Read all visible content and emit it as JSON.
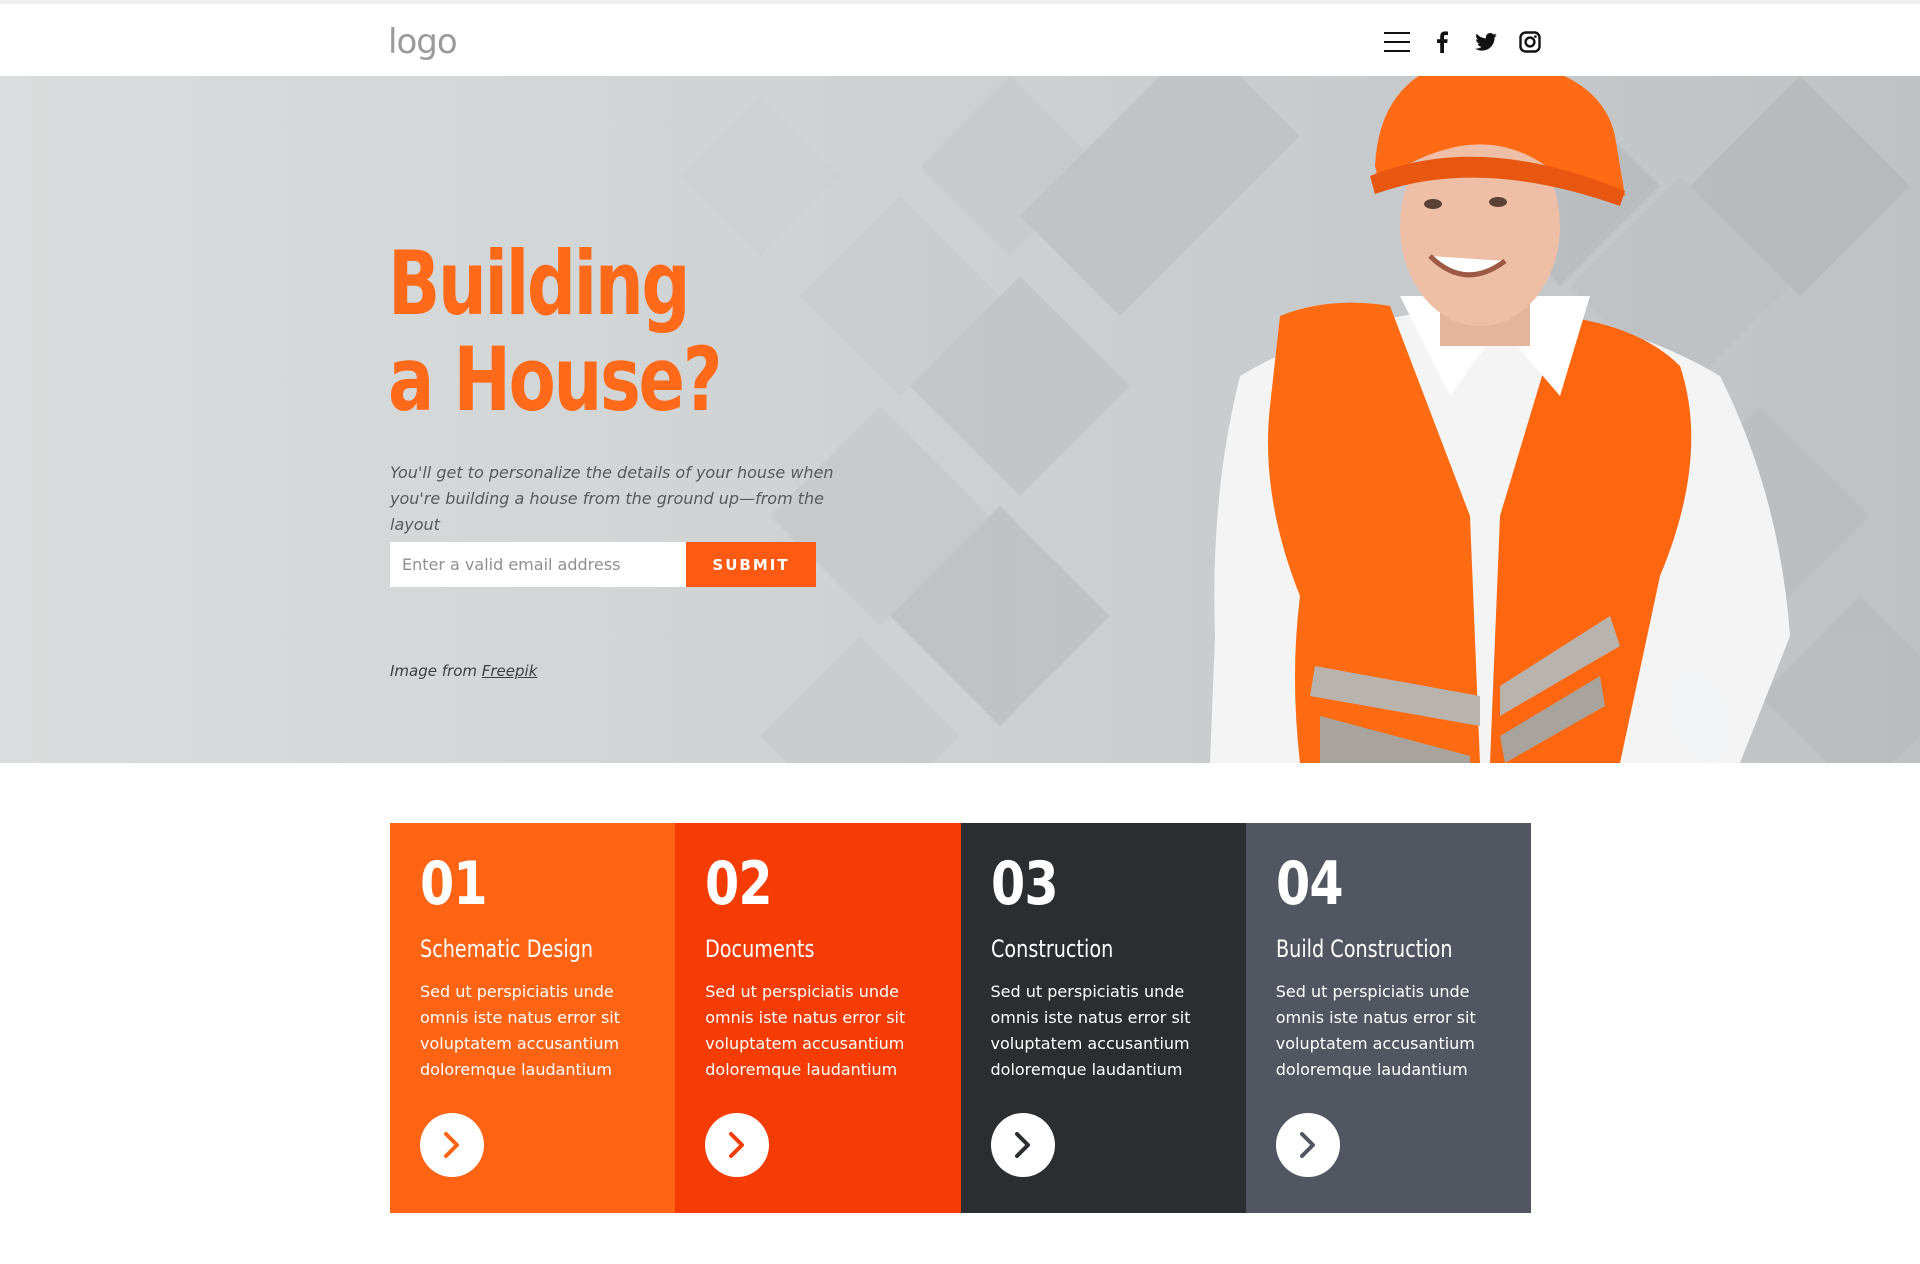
{
  "header": {
    "logo_text": "logo",
    "icons": [
      "menu-icon",
      "facebook-icon",
      "twitter-icon",
      "instagram-icon"
    ]
  },
  "hero": {
    "title_line1": "Building",
    "title_line2": "a House?",
    "subtitle": "You'll get to personalize the details of your house when you're building a house from the ground up—from the layout",
    "email_placeholder": "Enter a valid email address",
    "submit_label": "SUBMIT",
    "credit_prefix": "Image from ",
    "credit_link": "Freepik",
    "accent_color": "#ff6a1a"
  },
  "cards": [
    {
      "number": "01",
      "title": "Schematic Design",
      "text": "Sed ut perspiciatis unde omnis iste natus error sit voluptatem accusantium doloremque laudantium",
      "bg": "#ff6414",
      "arrow_color": "#ff6414"
    },
    {
      "number": "02",
      "title": "Documents",
      "text": "Sed ut perspiciatis unde omnis iste natus error sit voluptatem accusantium doloremque laudantium",
      "bg": "#f43c04",
      "arrow_color": "#f43c04"
    },
    {
      "number": "03",
      "title": "Construction",
      "text": "Sed ut perspiciatis unde omnis iste natus error sit voluptatem accusantium doloremque laudantium",
      "bg": "#2b2d31",
      "arrow_color": "#2b2d31"
    },
    {
      "number": "04",
      "title": "Build Construction",
      "text": "Sed ut perspiciatis unde omnis iste natus error sit voluptatem accusantium doloremque laudantium",
      "bg": "#525660",
      "arrow_color": "#525660"
    }
  ]
}
